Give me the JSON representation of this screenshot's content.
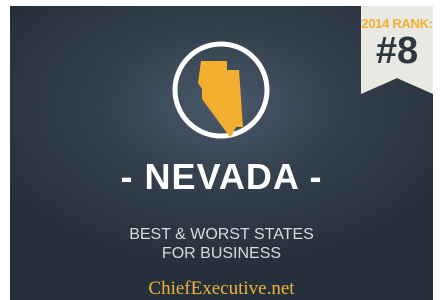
{
  "colors": {
    "background": "#2d3741",
    "accent": "#f2ae2e",
    "ribbon": "#e9e9e4",
    "text": "#ffffff"
  },
  "badge": {
    "label": "2014 RANK:",
    "rank": "#8"
  },
  "emblem": {
    "icon": "nevada-state-shape-icon"
  },
  "state": {
    "name": "- NEVADA -"
  },
  "subtitle": {
    "line1": "BEST & WORST STATES",
    "line2": "FOR BUSINESS"
  },
  "brand": {
    "name": "ChiefExecutive.net"
  }
}
